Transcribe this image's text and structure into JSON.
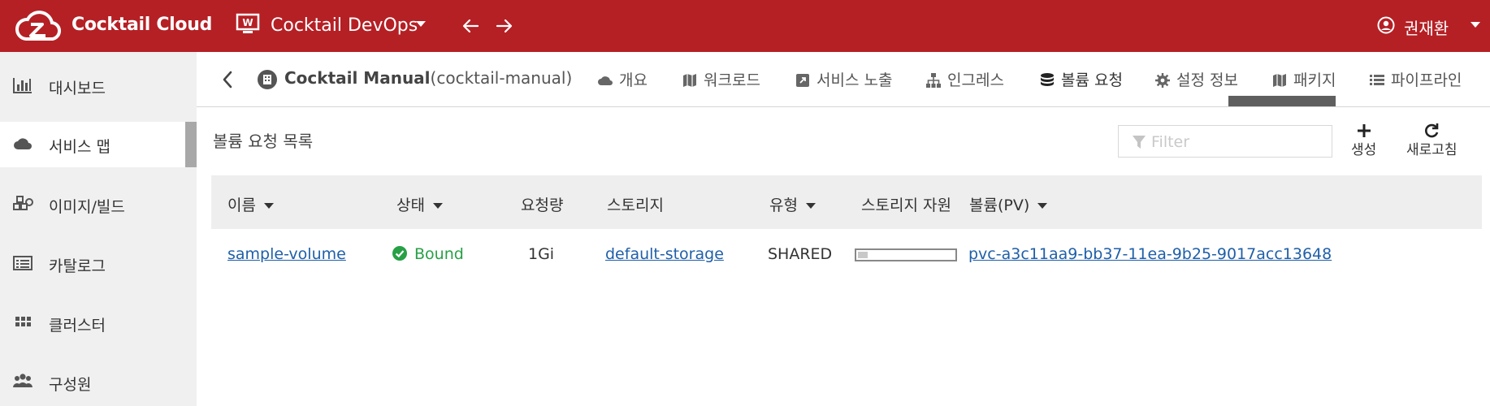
{
  "topbar": {
    "brand": "Cocktail Cloud",
    "project": "Cocktail DevOps",
    "user": "권재환",
    "bg_color": "#b52025"
  },
  "sidebar": {
    "items": [
      {
        "label": "대시보드",
        "icon": "bar-chart-icon"
      },
      {
        "label": "서비스 맵",
        "icon": "cloud-icon",
        "active": true
      },
      {
        "label": "이미지/빌드",
        "icon": "cubes-icon"
      },
      {
        "label": "카탈로그",
        "icon": "list-alt-icon"
      },
      {
        "label": "클러스터",
        "icon": "grid-icon"
      },
      {
        "label": "구성원",
        "icon": "users-icon"
      }
    ]
  },
  "service": {
    "name": "Cocktail Manual",
    "id": "(cocktail-manual)"
  },
  "tabs": [
    {
      "label": "개요",
      "icon": "cloud-icon"
    },
    {
      "label": "워크로드",
      "icon": "map-icon"
    },
    {
      "label": "서비스 노출",
      "icon": "external-link-icon"
    },
    {
      "label": "인그레스",
      "icon": "sitemap-icon"
    },
    {
      "label": "볼륨 요청",
      "icon": "database-icon",
      "active": true
    },
    {
      "label": "설정 정보",
      "icon": "gear-icon"
    },
    {
      "label": "패키지",
      "icon": "map-icon"
    },
    {
      "label": "파이프라인",
      "icon": "list-icon"
    }
  ],
  "content": {
    "title": "볼륨 요청 목록",
    "filter_placeholder": "Filter",
    "create_label": "생성",
    "refresh_label": "새로고침"
  },
  "table": {
    "headers": [
      "이름",
      "상태",
      "요청량",
      "스토리지",
      "유형",
      "스토리지 자원",
      "볼륨(PV)"
    ],
    "rows": [
      {
        "name": "sample-volume",
        "status": "Bound",
        "capacity": "1Gi",
        "storage": "default-storage",
        "type": "SHARED",
        "usage_fraction": 0.1,
        "pv": "pvc-a3c11aa9-bb37-11ea-9b25-9017acc13648"
      }
    ]
  },
  "colors": {
    "accent": "#b52025",
    "link": "#1f5fa8",
    "success": "#27a046"
  }
}
